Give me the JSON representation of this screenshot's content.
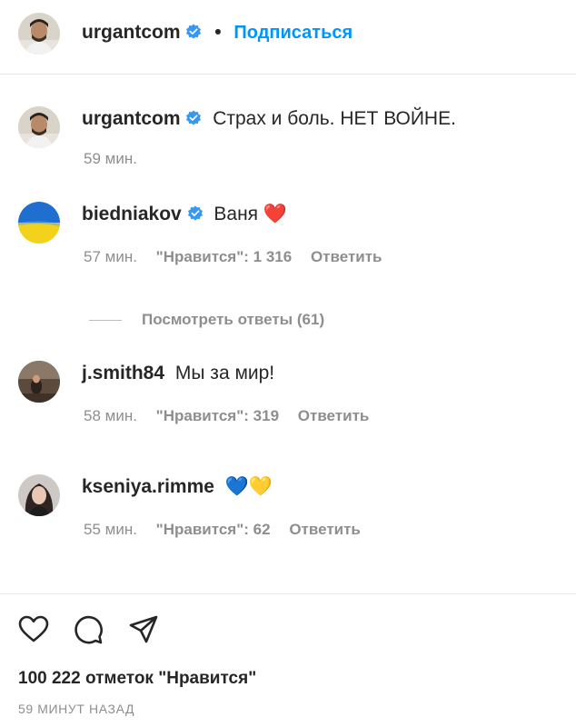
{
  "header": {
    "username": "urgantcom",
    "separator": "•",
    "follow_label": "Подписаться"
  },
  "comments": [
    {
      "username": "urgantcom",
      "verified": true,
      "text": "Страх и боль. НЕТ ВОЙНЕ.",
      "time": "59 мин.",
      "likes": "",
      "reply": ""
    },
    {
      "username": "biedniakov",
      "verified": true,
      "text": "Ваня ❤️",
      "time": "57 мин.",
      "likes": "\"Нравится\": 1 316",
      "reply": "Ответить"
    },
    {
      "username": "j.smith84",
      "verified": false,
      "text": "Мы за мир!",
      "time": "58 мин.",
      "likes": "\"Нравится\": 319",
      "reply": "Ответить"
    },
    {
      "username": "kseniya.rimme",
      "verified": false,
      "text": "💙💛",
      "time": "55 мин.",
      "likes": "\"Нравится\": 62",
      "reply": "Ответить"
    }
  ],
  "view_replies_label": "Посмотреть ответы (61)",
  "footer": {
    "icons": [
      "heart-icon",
      "comment-icon",
      "share-icon"
    ],
    "likes_count": "100 222 отметок \"Нравится\"",
    "time_ago": "59 МИНУТ НАЗАД"
  },
  "colors": {
    "accent": "#0095f6",
    "text": "#262626",
    "muted": "#8e8e8e",
    "divider": "#e6e6e6"
  }
}
